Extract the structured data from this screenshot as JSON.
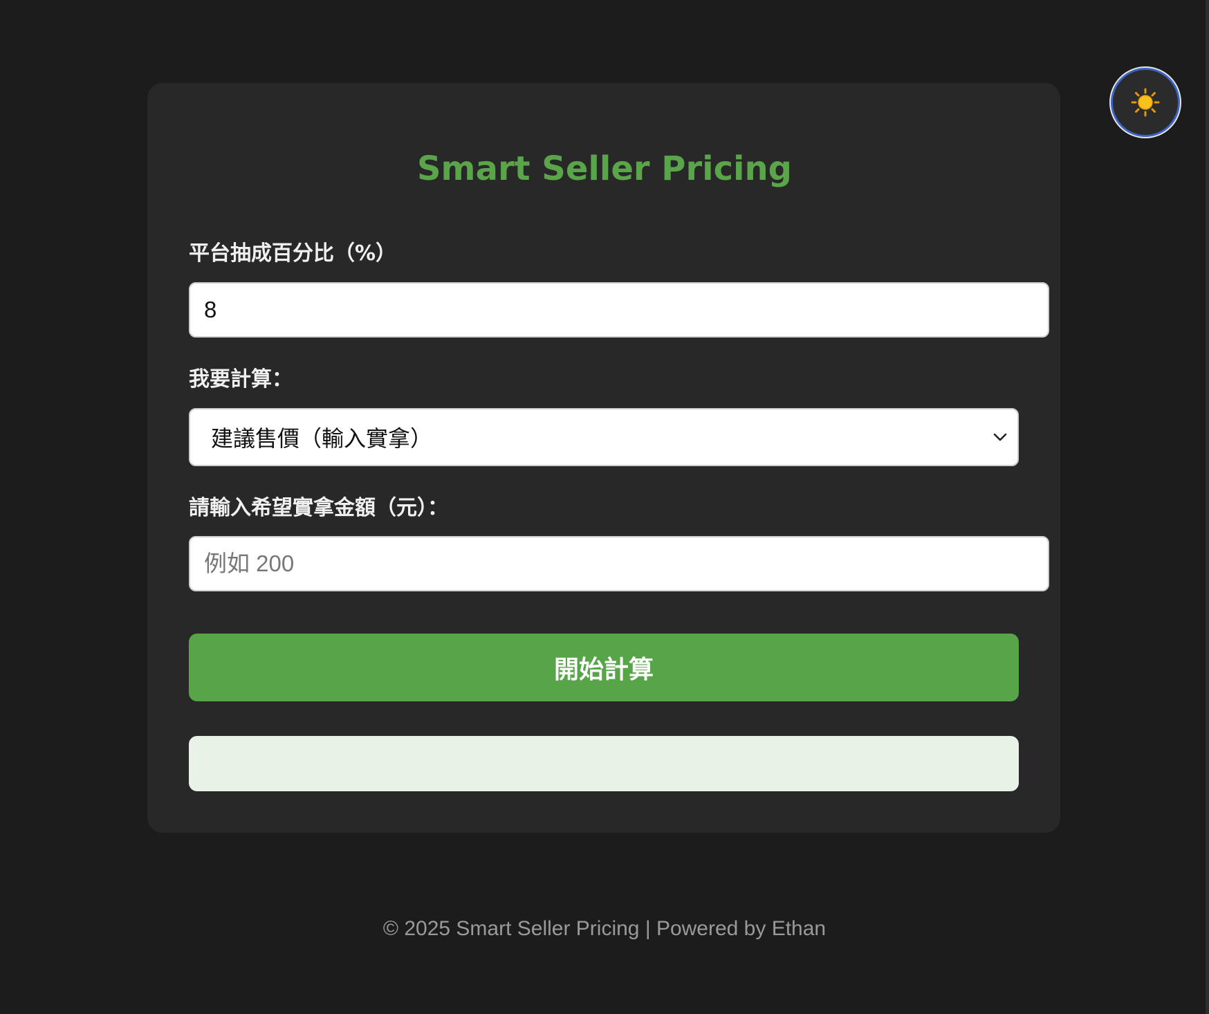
{
  "app": {
    "title": "Smart Seller Pricing"
  },
  "theme_toggle": {
    "icon": "sun-icon",
    "accent": "#3d63c4"
  },
  "form": {
    "commission": {
      "label": "平台抽成百分比（%）",
      "value": "8"
    },
    "mode": {
      "label": "我要計算：",
      "selected": "建議售價（輸入實拿）"
    },
    "target": {
      "label": "請輸入希望實拿金額（元）：",
      "value": "",
      "placeholder": "例如 200"
    },
    "submit_label": "開始計算"
  },
  "result": {
    "text": ""
  },
  "footer": {
    "text": "© 2025 Smart Seller Pricing | Powered by Ethan"
  },
  "colors": {
    "background": "#1c1c1c",
    "card": "#282828",
    "brand_green": "#58a448",
    "result_bg": "#e8f2e6"
  }
}
